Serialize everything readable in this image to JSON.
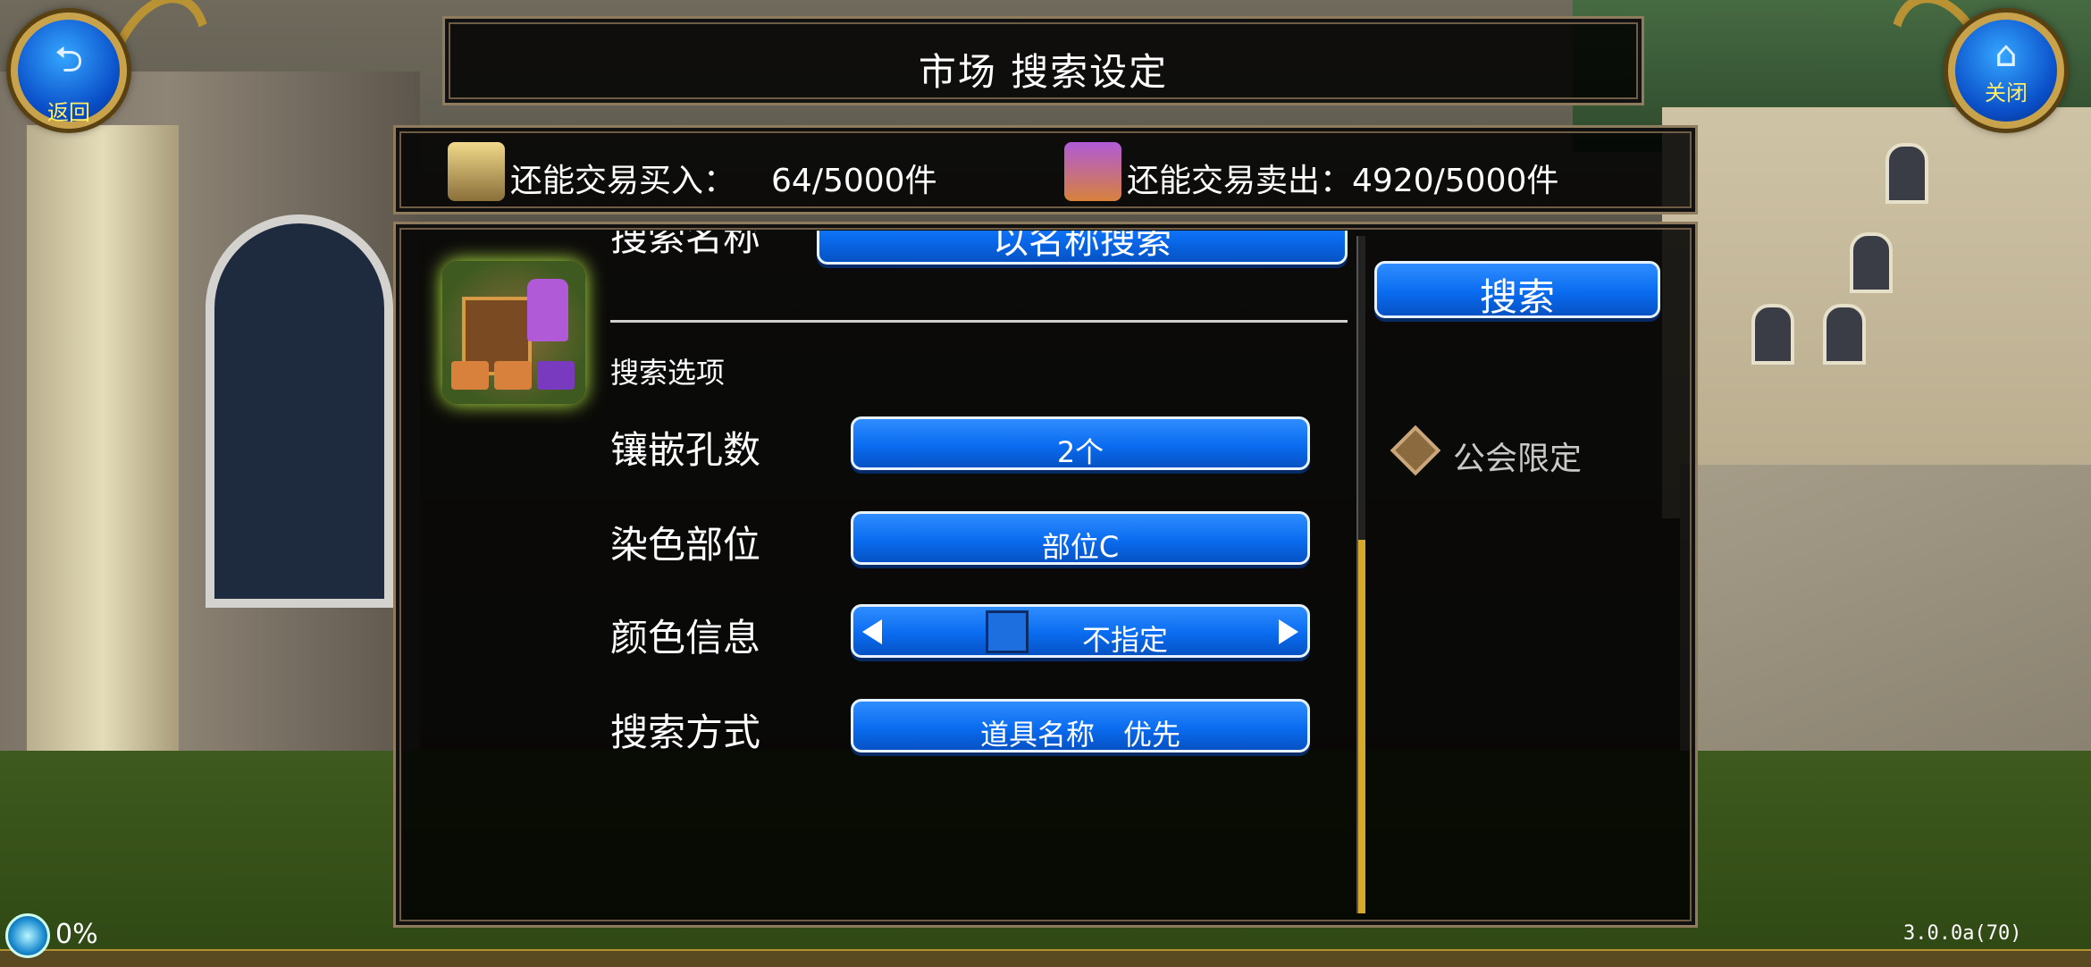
{
  "header": {
    "title": "市场 搜索设定",
    "back_label": "返回",
    "close_label": "关闭",
    "back_icon": "return-arrow-icon",
    "close_icon": "home-icon"
  },
  "trade_stats": {
    "buy_label": "还能交易买入：",
    "buy_value": "64/5000件",
    "sell_label": "还能交易卖出：",
    "sell_value": "4920/5000件"
  },
  "search": {
    "name_label": "搜索名称",
    "name_button": "以名称搜索",
    "search_button": "搜索",
    "options_heading": "搜索选项",
    "guild_only_label": "公会限定"
  },
  "options": {
    "slots": {
      "label": "镶嵌孔数",
      "value": "2个"
    },
    "dye_part": {
      "label": "染色部位",
      "value": "部位C"
    },
    "color_info": {
      "label": "颜色信息",
      "value": "不指定"
    },
    "search_mode": {
      "label": "搜索方式",
      "value": "道具名称　优先"
    }
  },
  "status": {
    "progress": "0%",
    "version": "3.0.0a(70)"
  },
  "colors": {
    "accent_blue": "#0a6cf0",
    "gold": "#c9a24c",
    "scroll_thumb": "#d7a92a"
  }
}
